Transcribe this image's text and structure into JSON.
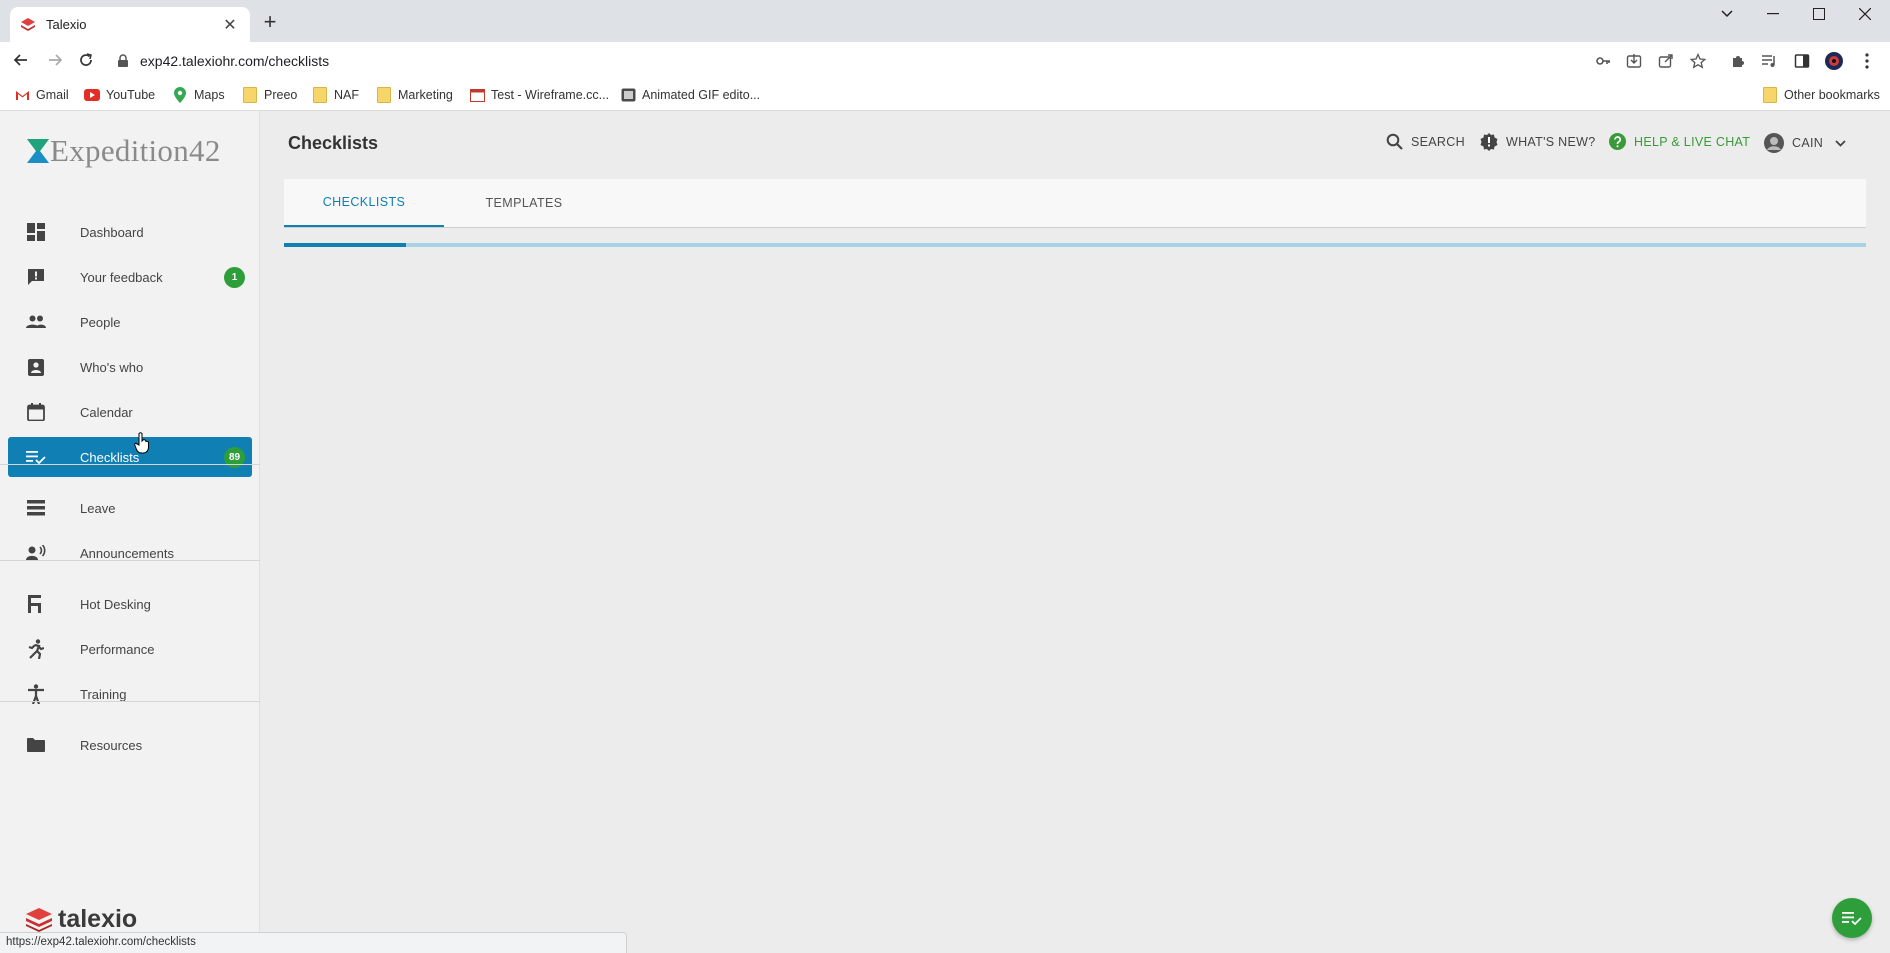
{
  "browser": {
    "tab_title": "Talexio",
    "url": "exp42.talexiohr.com/checklists",
    "status_url": "https://exp42.talexiohr.com/checklists",
    "bookmarks": [
      "Gmail",
      "YouTube",
      "Maps",
      "Preeo",
      "NAF",
      "Marketing",
      "Test - Wireframe.cc...",
      "Animated GIF edito..."
    ],
    "other_bookmarks": "Other bookmarks"
  },
  "app": {
    "logo_text": "Expedition42",
    "footer_logo_text": "talexio",
    "page_title": "Checklists",
    "header": {
      "search": "SEARCH",
      "whats_new": "WHAT'S NEW?",
      "help": "HELP & LIVE CHAT",
      "user": "CAIN"
    },
    "tabs": [
      {
        "label": "CHECKLISTS",
        "active": true
      },
      {
        "label": "TEMPLATES",
        "active": false
      }
    ],
    "loading_progress": 0.077,
    "nav": [
      {
        "label": "Dashboard",
        "icon": "dashboard-icon"
      },
      {
        "label": "Your feedback",
        "icon": "feedback-icon",
        "badge": "1"
      },
      {
        "label": "People",
        "icon": "people-icon"
      },
      {
        "label": "Who's who",
        "icon": "contact-card-icon"
      },
      {
        "label": "Calendar",
        "icon": "calendar-icon"
      },
      {
        "label": "Checklists",
        "icon": "checklist-icon",
        "badge": "89",
        "active": true
      },
      {
        "label": "Leave",
        "icon": "leave-icon"
      },
      {
        "label": "Announcements",
        "icon": "announcement-icon"
      },
      {
        "label": "Hot Desking",
        "icon": "hot-desk-icon"
      },
      {
        "label": "Performance",
        "icon": "performance-icon"
      },
      {
        "label": "Training",
        "icon": "training-icon"
      },
      {
        "label": "Resources",
        "icon": "folder-icon"
      }
    ]
  },
  "colors": {
    "primary": "#0f7fb4",
    "success": "#2e9e3a",
    "progress_track": "#a7d3e6"
  }
}
